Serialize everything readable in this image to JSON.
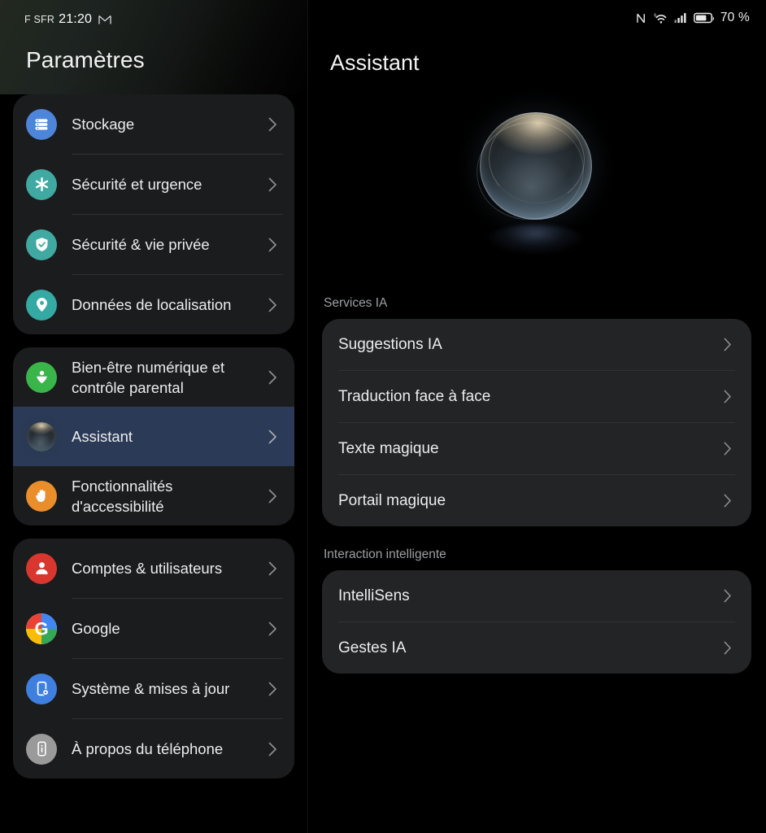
{
  "statusbar": {
    "carrier": "F SFR",
    "time": "21:20",
    "notification_icon": "gmail-icon",
    "nfc_icon": "nfc-icon",
    "wifi_icon": "wifi-6-icon",
    "signal_icon": "cellular-signal-icon",
    "battery_icon": "battery-icon",
    "battery_level": "70 %"
  },
  "sidebar": {
    "title": "Paramètres",
    "groups": [
      {
        "items": [
          {
            "label": "Stockage",
            "icon": "storage-icon",
            "color": "#4d85da",
            "selected": false
          },
          {
            "label": "Sécurité et urgence",
            "icon": "emergency-asterisk-icon",
            "color": "#3fa9a2",
            "selected": false
          },
          {
            "label": "Sécurité & vie privée",
            "icon": "shield-check-icon",
            "color": "#3fa9a2",
            "selected": false
          },
          {
            "label": "Données de localisation",
            "icon": "location-pin-icon",
            "color": "#35a9a4",
            "selected": false
          }
        ]
      },
      {
        "items": [
          {
            "label": "Bien-être numérique et contrôle parental",
            "icon": "wellbeing-heart-person-icon",
            "color": "#39b54a",
            "selected": false
          },
          {
            "label": "Assistant",
            "icon": "assistant-orb-icon",
            "color": "#2b3a56",
            "selected": true
          },
          {
            "label": "Fonctionnalités d'accessibilité",
            "icon": "accessibility-hand-icon",
            "color": "#e98e2b",
            "selected": false
          }
        ]
      },
      {
        "items": [
          {
            "label": "Comptes & utilisateurs",
            "icon": "account-person-icon",
            "color": "#d9362f",
            "selected": false
          },
          {
            "label": "Google",
            "icon": "google-g-icon",
            "color": "#ffffff",
            "selected": false
          },
          {
            "label": "Système & mises à jour",
            "icon": "system-update-phone-icon",
            "color": "#3f7fe0",
            "selected": false
          },
          {
            "label": "À propos du téléphone",
            "icon": "about-info-icon",
            "color": "#9a9a9a",
            "selected": false
          }
        ]
      }
    ]
  },
  "main": {
    "title": "Assistant",
    "hero_icon": "assistant-orb-hero-image",
    "sections": [
      {
        "label": "Services IA",
        "items": [
          {
            "label": "Suggestions IA"
          },
          {
            "label": "Traduction face à face"
          },
          {
            "label": "Texte magique"
          },
          {
            "label": "Portail magique"
          }
        ]
      },
      {
        "label": "Interaction intelligente",
        "items": [
          {
            "label": "IntelliSens"
          },
          {
            "label": "Gestes IA"
          }
        ]
      }
    ]
  },
  "colors": {
    "background": "#000000",
    "card": "#232426",
    "sidebar_card": "#1b1c1d",
    "selected_row": "#2b3a56",
    "divider": "#313234",
    "text_primary": "#ececed",
    "text_secondary": "#9d9fa3"
  }
}
